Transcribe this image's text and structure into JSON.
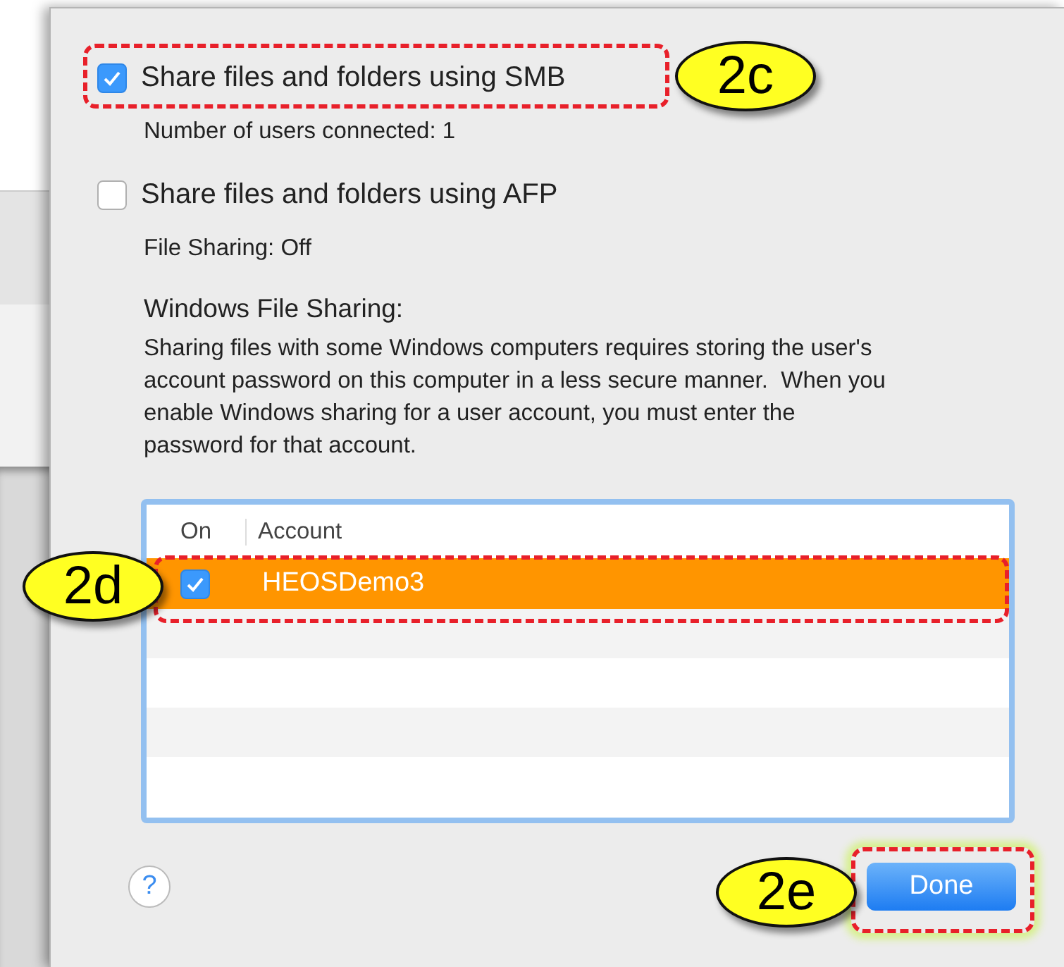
{
  "sharing_options": [
    {
      "label": "Share files and folders using SMB",
      "checked": true,
      "status": "Number of users connected: 1"
    },
    {
      "label": "Share files and folders using AFP",
      "checked": false,
      "status": "File Sharing: Off"
    }
  ],
  "windows_file_sharing": {
    "heading": "Windows File Sharing:",
    "description": "Sharing files with some Windows computers requires storing the user's account password on this computer in a less secure manner.  When you enable Windows sharing for a user account, you must enter the password for that account."
  },
  "accounts_table": {
    "columns": [
      "On",
      "Account"
    ],
    "rows": [
      {
        "on": true,
        "account": "HEOSDemo3",
        "selected": true
      }
    ]
  },
  "help_button": {
    "label": "?"
  },
  "done_button": {
    "label": "Done"
  },
  "annotations": [
    {
      "label": "2c"
    },
    {
      "label": "2d"
    },
    {
      "label": "2e"
    }
  ]
}
